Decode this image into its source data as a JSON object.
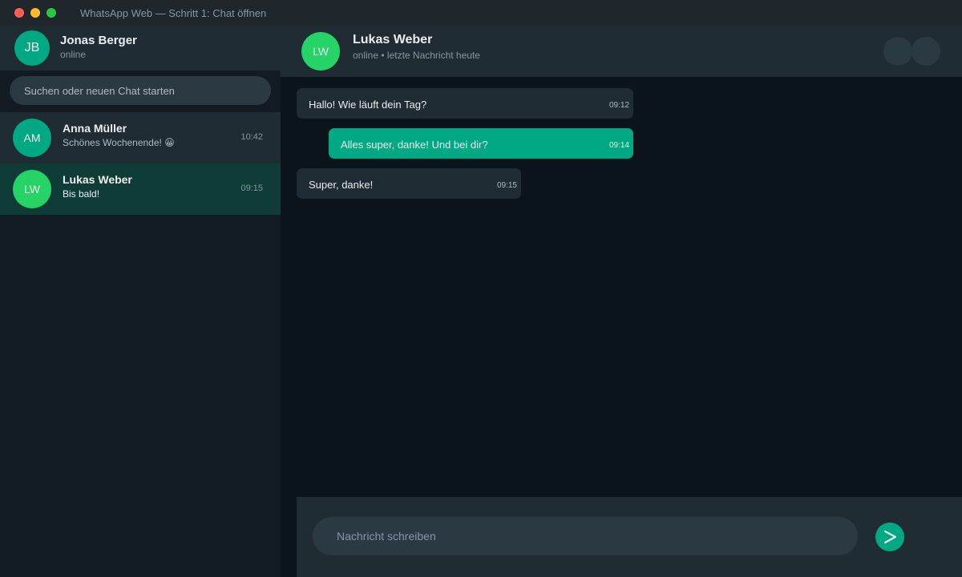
{
  "window": {
    "title": "WhatsApp Web — Schritt 1: Chat öffnen"
  },
  "profile": {
    "initials": "JB",
    "name": "Jonas Berger",
    "status": "online"
  },
  "search": {
    "placeholder": "Suchen oder neuen Chat starten"
  },
  "chats": [
    {
      "initials": "AM",
      "name": "Anna Müller",
      "preview": "Schönes Wochenende! 😀",
      "time": "10:42"
    },
    {
      "initials": "LW",
      "name": "Lukas Weber",
      "preview": "Bis bald!",
      "time": "09:15",
      "selected": true
    }
  ],
  "conversation": {
    "initials": "LW",
    "name": "Lukas Weber",
    "status": "online • letzte Nachricht heute",
    "messages": [
      {
        "direction": "in",
        "text": "Hallo! Wie läuft dein Tag?",
        "time": "09:12"
      },
      {
        "direction": "out",
        "text": "Alles super, danke! Und bei dir?",
        "time": "09:14"
      },
      {
        "direction": "in",
        "text": "Super, danke!",
        "time": "09:15"
      }
    ]
  },
  "composer": {
    "placeholder": "Nachricht schreiben",
    "send_icon": "send-icon"
  },
  "colors": {
    "accent": "#00a884",
    "online_green": "#25d366",
    "panel": "#202c33",
    "background": "#0b141a"
  }
}
